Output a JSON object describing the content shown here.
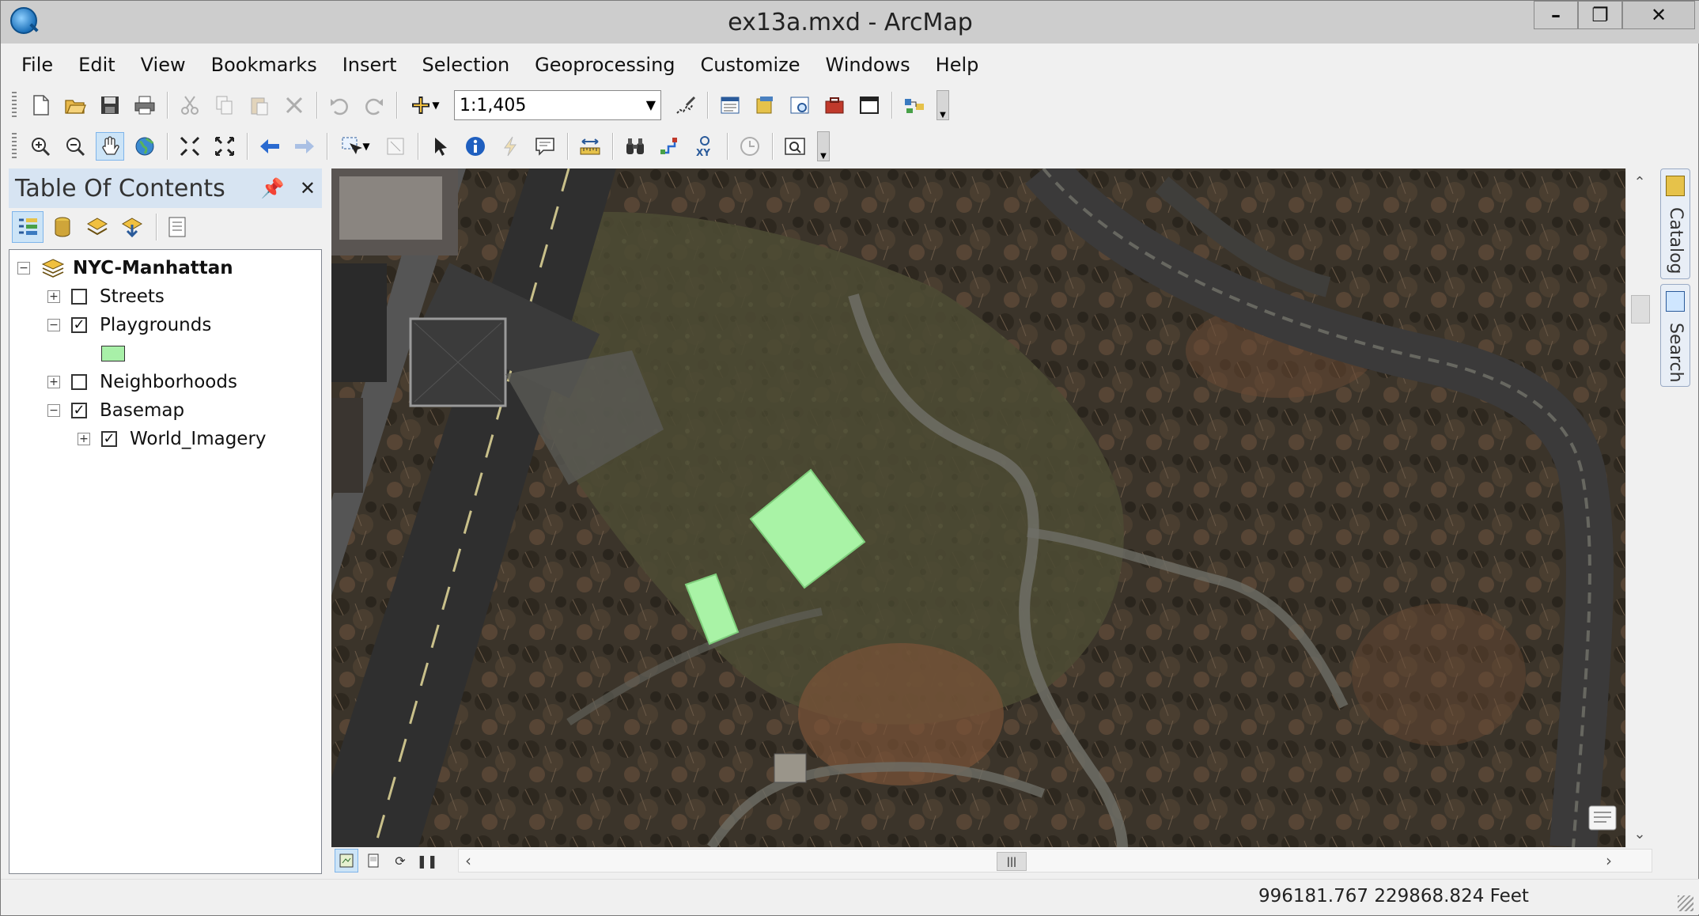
{
  "window": {
    "title": "ex13a.mxd - ArcMap",
    "minimize": "‒",
    "maximize": "□",
    "close": "✕"
  },
  "menu": [
    "File",
    "Edit",
    "View",
    "Bookmarks",
    "Insert",
    "Selection",
    "Geoprocessing",
    "Customize",
    "Windows",
    "Help"
  ],
  "standard_toolbar": {
    "scale_value": "1:1,405"
  },
  "toc": {
    "title": "Table Of Contents",
    "pin": "⌖",
    "close": "✕",
    "data_frame": "NYC-Manhattan",
    "layers": [
      {
        "label": "Streets",
        "checked": false,
        "expanded": false
      },
      {
        "label": "Playgrounds",
        "checked": true,
        "expanded": true
      },
      {
        "label": "Neighborhoods",
        "checked": false,
        "expanded": false
      },
      {
        "label": "Basemap",
        "checked": true,
        "expanded": true
      },
      {
        "label": "World_Imagery",
        "checked": true,
        "expanded": false
      }
    ],
    "playground_symbol_color": "#a8f0a8"
  },
  "map": {
    "playground_fill": "#a9f3a6",
    "road_color": "#3b3a3a"
  },
  "side_tabs": [
    "Catalog",
    "Search"
  ],
  "status": {
    "coordinates": "996181.767  229868.824 Feet"
  }
}
